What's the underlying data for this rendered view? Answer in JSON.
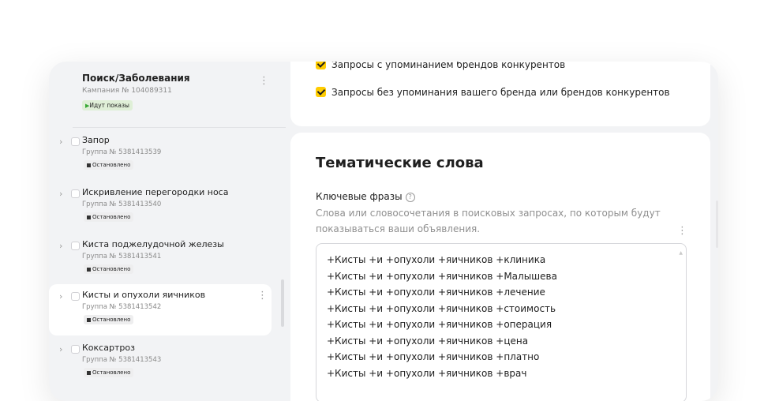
{
  "sidebar": {
    "campaign": {
      "title": "Поиск/Заболевания",
      "subtitle": "Кампания № 104089311",
      "status": "Идут показы"
    },
    "groups": [
      {
        "name": "Запор",
        "subtitle": "Группа № 5381413539",
        "status": "Остановлено"
      },
      {
        "name": "Искривление перегородки носа",
        "subtitle": "Группа № 5381413540",
        "status": "Остановлено"
      },
      {
        "name": "Киста поджелудочной железы",
        "subtitle": "Группа № 5381413541",
        "status": "Остановлено"
      },
      {
        "name": "Кисты и опухоли яичников",
        "subtitle": "Группа № 5381413542",
        "status": "Остановлено"
      },
      {
        "name": "Коксартроз",
        "subtitle": "Группа № 5381413543",
        "status": "Остановлено"
      }
    ]
  },
  "queries": {
    "option1": "Запросы с упоминанием брендов конкурентов",
    "option2": "Запросы без упоминания вашего бренда или брендов конкурентов"
  },
  "thematic": {
    "title": "Тематические слова",
    "label": "Ключевые фразы",
    "help_glyph": "?",
    "hint": "Слова или словосочетания в поисковых запросах, по которым будут показываться ваши объявления.",
    "phrases": [
      "+Кисты +и +опухоли +яичников +клиника",
      "+Кисты +и +опухоли +яичников +Малышева",
      "+Кисты +и +опухоли +яичников +лечение",
      "+Кисты +и +опухоли +яичников +стоимость",
      "+Кисты +и +опухоли +яичников +операция",
      "+Кисты +и +опухоли +яичников +цена",
      "+Кисты +и +опухоли +яичников +платно",
      "+Кисты +и +опухоли +яичников +врач"
    ]
  },
  "colors": {
    "accent": "#ffcc00",
    "running": "#37a834",
    "panel_bg": "#f2f3f5"
  }
}
